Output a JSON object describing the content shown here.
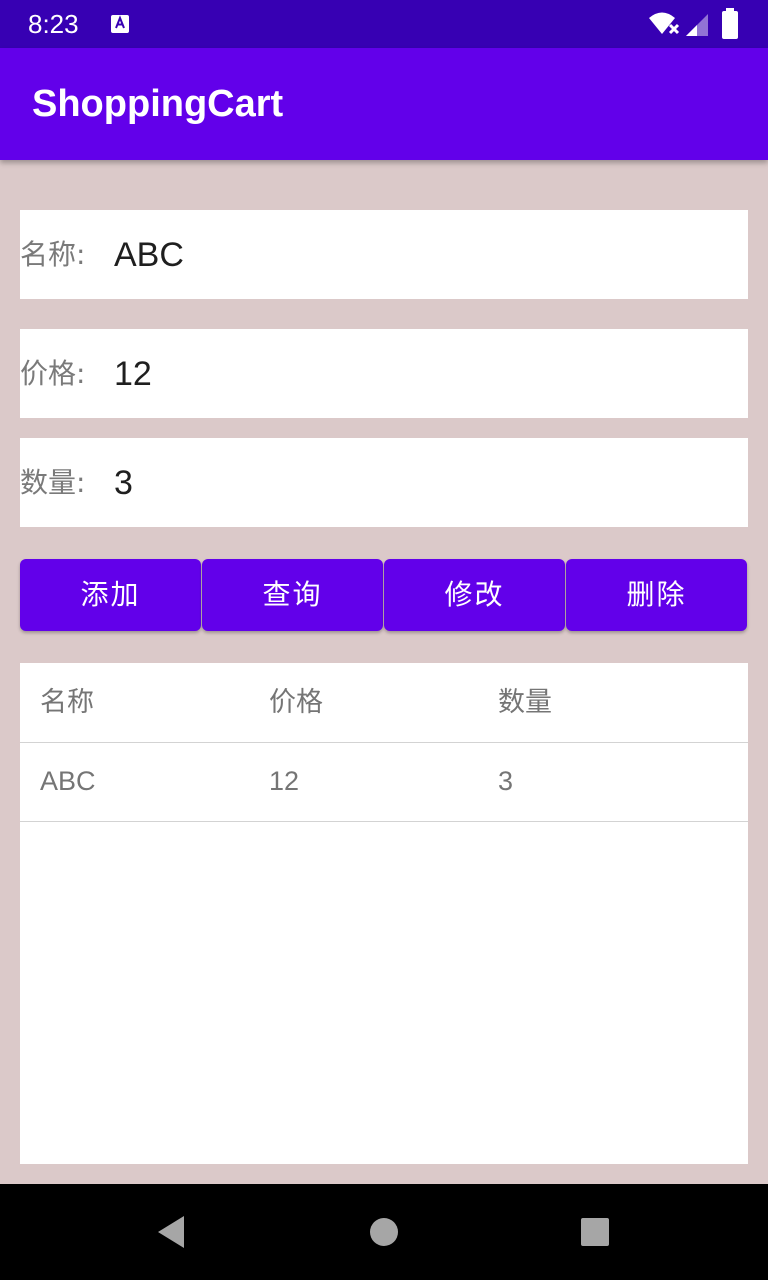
{
  "status_bar": {
    "time": "8:23",
    "notification_icon": "app-a-icon",
    "wifi_icon": "wifi-no-internet-icon",
    "signal_icon": "cell-signal-icon",
    "battery_icon": "battery-full-icon"
  },
  "app_bar": {
    "title": "ShoppingCart",
    "color": "#6200ea"
  },
  "form": {
    "name": {
      "label": "名称:",
      "value": "ABC"
    },
    "price": {
      "label": "价格:",
      "value": "12"
    },
    "quantity": {
      "label": "数量:",
      "value": "3"
    }
  },
  "buttons": {
    "add": "添加",
    "query": "查询",
    "modify": "修改",
    "delete": "删除"
  },
  "table": {
    "headers": [
      "名称",
      "价格",
      "数量"
    ],
    "rows": [
      [
        "ABC",
        "12",
        "3"
      ]
    ]
  },
  "nav_bar": {
    "back_icon": "back-triangle-icon",
    "home_icon": "home-circle-icon",
    "recents_icon": "recents-square-icon"
  },
  "colors": {
    "background": "#dbc9c9",
    "status_bar": "#3700b3",
    "accent": "#6200ea"
  }
}
